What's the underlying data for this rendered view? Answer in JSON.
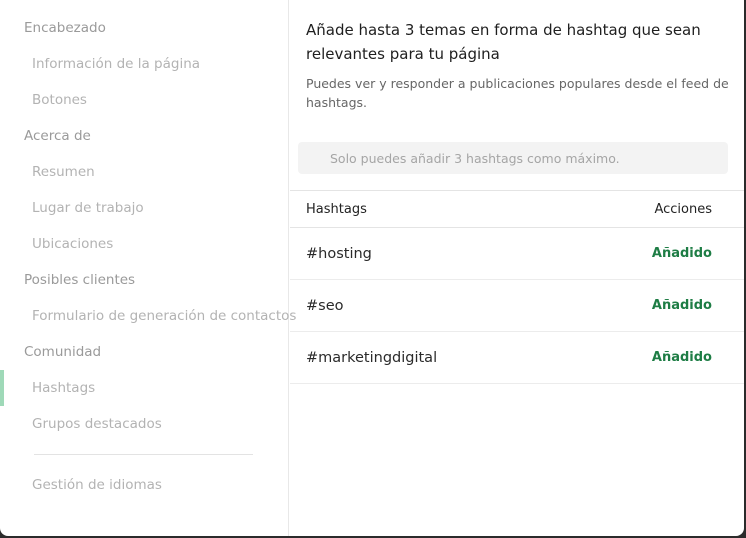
{
  "sidebar": {
    "items": [
      {
        "label": "Encabezado"
      },
      {
        "label": "Información de la página"
      },
      {
        "label": "Botones"
      },
      {
        "label": "Acerca de"
      },
      {
        "label": "Resumen"
      },
      {
        "label": "Lugar de trabajo"
      },
      {
        "label": "Ubicaciones"
      },
      {
        "label": "Posibles clientes"
      },
      {
        "label": "Formulario de generación de contactos"
      },
      {
        "label": "Comunidad"
      },
      {
        "label": "Hashtags"
      },
      {
        "label": "Grupos destacados"
      },
      {
        "label": "Gestión de idiomas"
      }
    ],
    "active_item": "Hashtags"
  },
  "main": {
    "heading": "Añade hasta 3 temas en forma de hashtag que sean relevantes para tu página",
    "subtext": "Puedes ver y responder a publicaciones populares desde el feed de hashtags.",
    "search": {
      "placeholder": "Solo puedes añadir 3 hashtags como máximo.",
      "value": ""
    },
    "table": {
      "headers": {
        "hashtags": "Hashtags",
        "actions": "Acciones"
      },
      "rows": [
        {
          "tag": "#hosting",
          "action": "Añadido"
        },
        {
          "tag": "#seo",
          "action": "Añadido"
        },
        {
          "tag": "#marketingdigital",
          "action": "Añadido"
        }
      ]
    }
  },
  "colors": {
    "accent_green": "#1e7d45",
    "active_bar": "#9fd9b8"
  }
}
